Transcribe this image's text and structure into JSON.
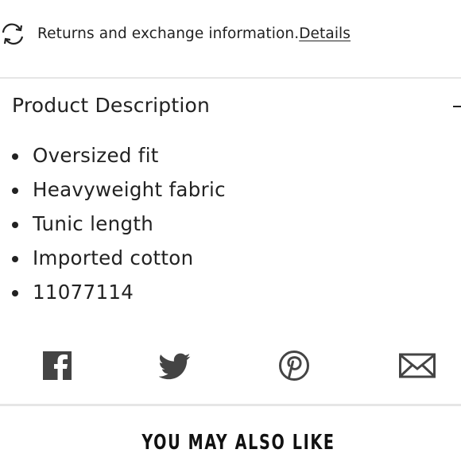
{
  "returns": {
    "text": "Returns and exchange information.",
    "link_label": "Details",
    "icon": "refresh-arrows-icon"
  },
  "product_description": {
    "title": "Product Description",
    "toggle_symbol": "−",
    "items": [
      "Oversized fit",
      "Heavyweight fabric",
      "Tunic length",
      "Imported cotton",
      "11077114"
    ]
  },
  "share": {
    "icons": [
      "facebook-icon",
      "twitter-icon",
      "pinterest-icon",
      "email-icon"
    ],
    "icon_color": "#444444"
  },
  "recommendations": {
    "heading": "YOU MAY ALSO LIKE"
  }
}
